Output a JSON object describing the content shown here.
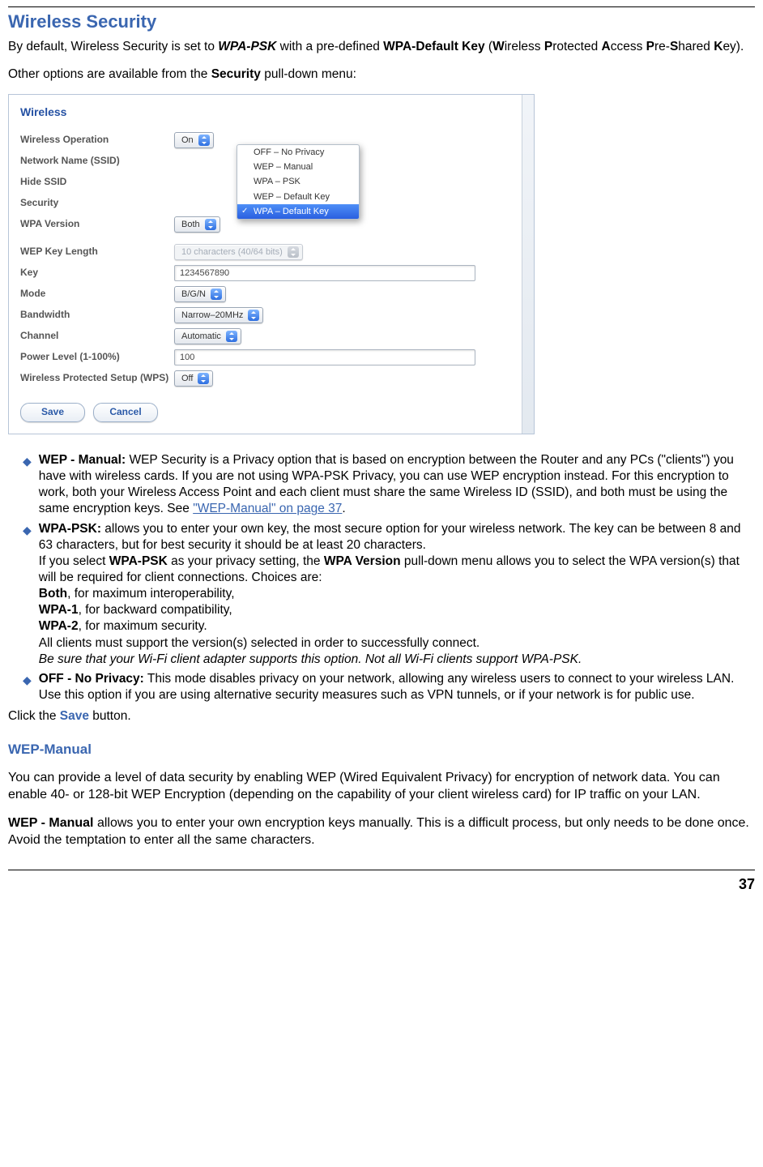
{
  "heading": "Wireless Security",
  "intro": {
    "line1_pre": "By default, Wireless Security is set to ",
    "line1_em": "WPA-PSK",
    "line1_mid": " with a pre-defined ",
    "line1_bold": "WPA-Default Key",
    "line1_paren": " (Wireless Protected Access Pre-Shared Key).",
    "line2_pre": "Other options are available from the ",
    "line2_bold": "Security",
    "line2_post": " pull-down menu:"
  },
  "panel": {
    "title": "Wireless",
    "rows": {
      "wireless_operation": {
        "label": "Wireless Operation",
        "value": "On"
      },
      "ssid": {
        "label": "Network Name (SSID)"
      },
      "hide_ssid": {
        "label": "Hide SSID"
      },
      "security": {
        "label": "Security"
      },
      "wpa_version": {
        "label": "WPA Version",
        "value": "Both"
      },
      "wep_key_length": {
        "label": "WEP Key Length",
        "value": "10 characters (40/64 bits)"
      },
      "key": {
        "label": "Key",
        "value": "1234567890"
      },
      "mode": {
        "label": "Mode",
        "value": "B/G/N"
      },
      "bandwidth": {
        "label": "Bandwidth",
        "value": "Narrow–20MHz"
      },
      "channel": {
        "label": "Channel",
        "value": "Automatic"
      },
      "power_level": {
        "label": "Power Level (1-100%)",
        "value": "100"
      },
      "wps": {
        "label": "Wireless Protected Setup (WPS)",
        "value": "Off"
      }
    },
    "dropdown_options": [
      "OFF – No Privacy",
      "WEP – Manual",
      "WPA – PSK",
      "WEP – Default Key",
      "WPA – Default Key"
    ],
    "buttons": {
      "save": "Save",
      "cancel": "Cancel"
    }
  },
  "bullets": {
    "wep_manual": {
      "title": "WEP - Manual:",
      "text": " WEP Security is a Privacy option that is based on encryption between the Router and any PCs (\"clients\") you have with wireless cards. If you are not using WPA-PSK Privacy, you can use WEP encryption instead. For this encryption to work, both your Wireless Access Point and each client must share the same Wireless ID (SSID), and both must be using the same encryption keys. See ",
      "link": "\"WEP-Manual\" on page 37",
      "post": "."
    },
    "wpa_psk": {
      "title": "WPA-PSK:",
      "text1": " allows you to enter your own key, the most secure option for your wireless network. The key can be between 8 and 63 characters, but for best security it should be at least 20 characters.",
      "text2_pre": "If you select ",
      "text2_b1": "WPA-PSK",
      "text2_mid": " as your privacy setting, the ",
      "text2_b2": "WPA Version",
      "text2_post": " pull-down menu allows you to select the WPA version(s) that will be required for client connections. Choices are:",
      "both": "Both",
      "both_t": ", for maximum interoperability,",
      "wpa1": "WPA-1",
      "wpa1_t": ", for backward compatibility,",
      "wpa2": "WPA-2",
      "wpa2_t": ", for maximum security.",
      "tail1": "All clients must support the version(s) selected in order to successfully connect.",
      "tail2": "Be sure that your Wi-Fi client adapter supports this option. Not all Wi-Fi clients support WPA-PSK."
    },
    "off": {
      "title": "OFF - No Privacy:",
      "text": " This mode disables privacy on your network, allowing any wireless users to connect to your wireless LAN. Use this option if you are using alternative security measures such as VPN tunnels, or if your network is for public use."
    }
  },
  "save_line": {
    "pre": "Click the ",
    "btn": "Save",
    "post": " button."
  },
  "sub_heading": "WEP-Manual",
  "wep_p1": "You can provide a level of data security by enabling WEP (Wired Equivalent Privacy) for encryption of network data. You can enable 40- or 128-bit WEP Encryption (depending on the capability of your client wireless card) for IP traffic on your LAN.",
  "wep_p2_b": "WEP - Manual",
  "wep_p2_t": " allows you to enter your own encryption keys manually. This is a difficult process, but only needs to be done once. Avoid the temptation to enter all the same characters.",
  "page_number": "37"
}
